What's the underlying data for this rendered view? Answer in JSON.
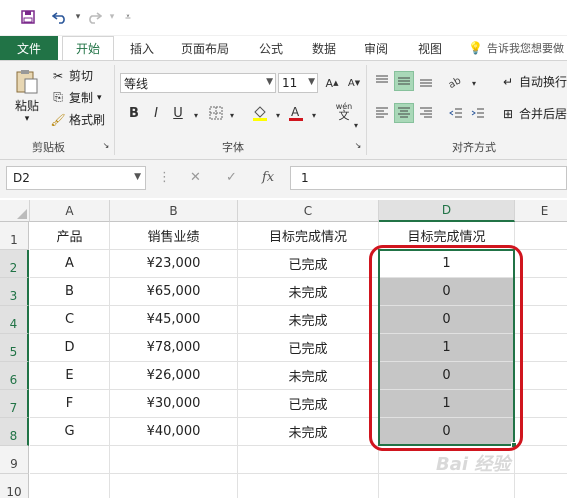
{
  "qat": {
    "save_icon": "save-icon",
    "undo_icon": "undo-icon",
    "redo_icon": "redo-icon",
    "customize_icon": "customize-qat-icon"
  },
  "tabs": {
    "file": "文件",
    "items": [
      "开始",
      "插入",
      "页面布局",
      "公式",
      "数据",
      "审阅",
      "视图"
    ],
    "active_index": 0,
    "tell_me": "告诉我您想要做"
  },
  "ribbon": {
    "clipboard": {
      "paste": "粘贴",
      "cut": "剪切",
      "copy": "复制",
      "format_painter": "格式刷",
      "label": "剪贴板"
    },
    "font": {
      "font_name": "等线",
      "font_size": "11",
      "bold": "B",
      "italic": "I",
      "underline": "U",
      "label": "字体",
      "phonetic": "wén"
    },
    "alignment": {
      "wrap_text": "自动换行",
      "merge_center": "合并后居",
      "label": "对齐方式"
    }
  },
  "formula_bar": {
    "name_box": "D2",
    "formula": "1",
    "fx": "fx"
  },
  "sheet": {
    "columns": [
      "A",
      "B",
      "C",
      "D",
      "E"
    ],
    "rows": [
      "1",
      "2",
      "3",
      "4",
      "5",
      "6",
      "7",
      "8",
      "9",
      "10"
    ],
    "header": [
      "产品",
      "销售业绩",
      "目标完成情况",
      "目标完成情况"
    ],
    "data": [
      [
        "A",
        "¥23,000",
        "已完成",
        "1"
      ],
      [
        "B",
        "¥65,000",
        "未完成",
        "0"
      ],
      [
        "C",
        "¥45,000",
        "未完成",
        "0"
      ],
      [
        "D",
        "¥78,000",
        "已完成",
        "1"
      ],
      [
        "E",
        "¥26,000",
        "未完成",
        "0"
      ],
      [
        "F",
        "¥30,000",
        "已完成",
        "1"
      ],
      [
        "G",
        "¥40,000",
        "未完成",
        "0"
      ]
    ]
  },
  "watermark": "Bai 经验",
  "colors": {
    "accent": "#217346",
    "highlight": "#d0151e",
    "selection": "#c6c6c6"
  }
}
